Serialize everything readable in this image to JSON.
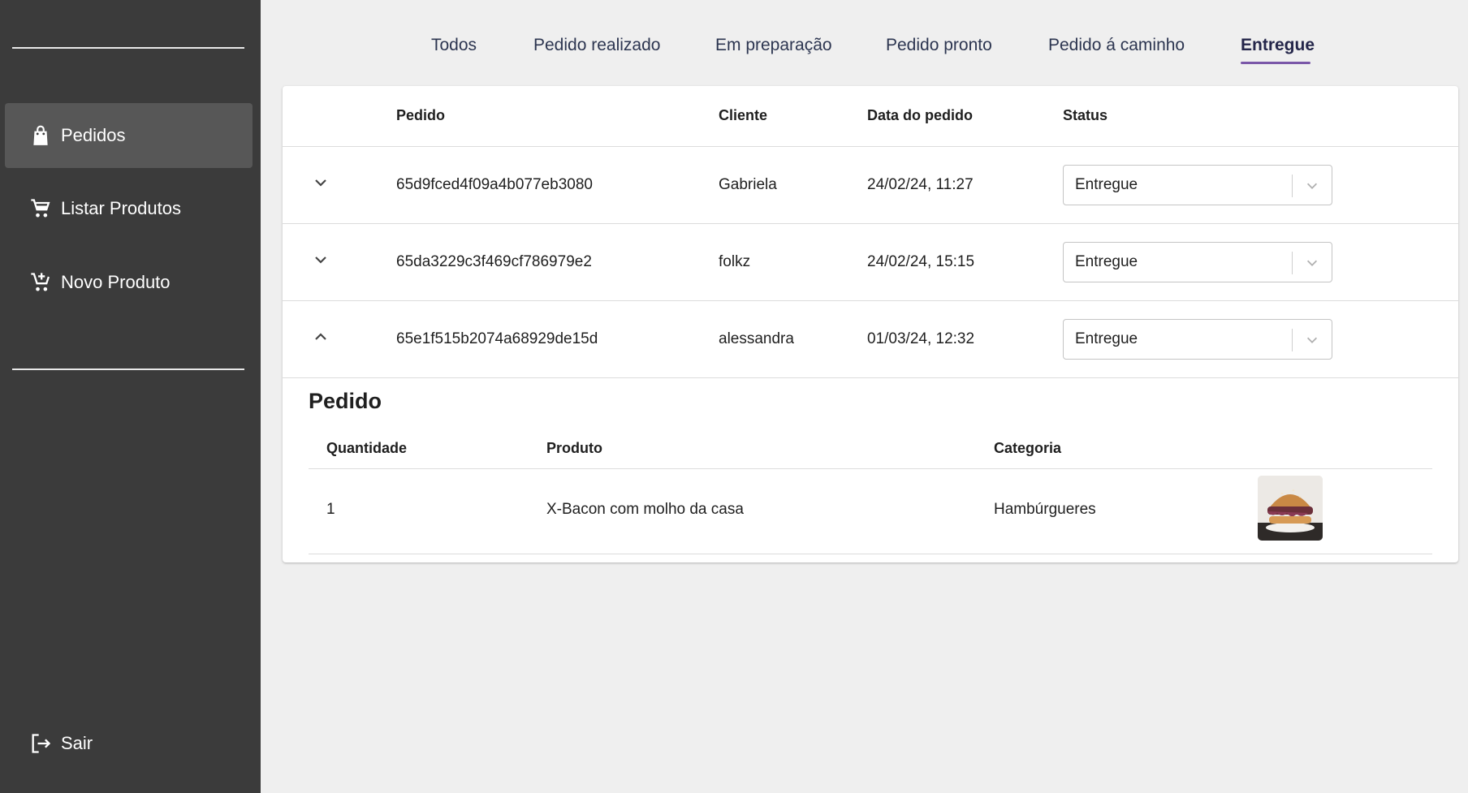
{
  "sidebar": {
    "items": [
      {
        "label": "Pedidos",
        "icon": "shopping-bag-icon",
        "active": true
      },
      {
        "label": "Listar Produtos",
        "icon": "shopping-cart-icon",
        "active": false
      },
      {
        "label": "Novo Produto",
        "icon": "add-to-cart-icon",
        "active": false
      }
    ],
    "logout": {
      "label": "Sair",
      "icon": "logout-icon"
    }
  },
  "tabs": [
    {
      "label": "Todos"
    },
    {
      "label": "Pedido realizado"
    },
    {
      "label": "Em preparação"
    },
    {
      "label": "Pedido pronto"
    },
    {
      "label": "Pedido á caminho"
    },
    {
      "label": "Entregue",
      "active": true
    }
  ],
  "table": {
    "headers": {
      "pedido": "Pedido",
      "cliente": "Cliente",
      "data": "Data do pedido",
      "status": "Status"
    },
    "rows": [
      {
        "id": "65d9fced4f09a4b077eb3080",
        "cliente": "Gabriela",
        "data": "24/02/24, 11:27",
        "status": "Entregue",
        "expanded": false
      },
      {
        "id": "65da3229c3f469cf786979e2",
        "cliente": "folkz",
        "data": "24/02/24, 15:15",
        "status": "Entregue",
        "expanded": false
      },
      {
        "id": "65e1f515b2074a68929de15d",
        "cliente": "alessandra",
        "data": "01/03/24, 12:32",
        "status": "Entregue",
        "expanded": true
      }
    ]
  },
  "detail": {
    "title": "Pedido",
    "headers": {
      "quantidade": "Quantidade",
      "produto": "Produto",
      "categoria": "Categoria"
    },
    "items": [
      {
        "quantidade": "1",
        "produto": "X-Bacon com molho da casa",
        "categoria": "Hambúrgueres"
      }
    ]
  },
  "colors": {
    "sidebar_bg": "#3b3b3b",
    "sidebar_active": "#575757",
    "tab_active_underline": "#7a57a8",
    "page_bg": "#efefef"
  }
}
